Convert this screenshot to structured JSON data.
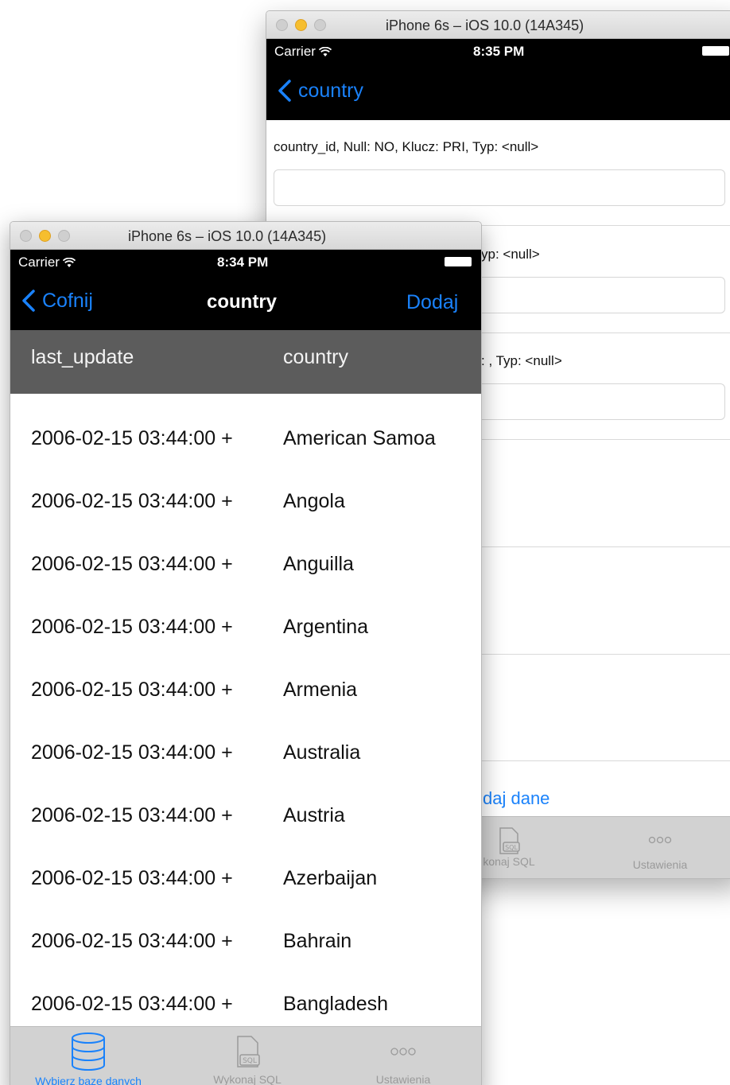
{
  "back_window": {
    "title": "iPhone 6s – iOS 10.0 (14A345)",
    "status": {
      "carrier": "Carrier",
      "time": "8:35 PM"
    },
    "nav": {
      "back_label": "country"
    },
    "fields": [
      {
        "label": "country_id, Null: NO, Klucz: PRI, Typ: <null>"
      },
      {
        "label": "yp: <null>"
      },
      {
        "label": ": , Typ: <null>"
      }
    ],
    "add_link": "daj dane",
    "tabs": [
      {
        "label": "konaj SQL",
        "icon": "sql-icon"
      },
      {
        "label": "Ustawienia",
        "icon": "more-icon"
      }
    ]
  },
  "front_window": {
    "title": "iPhone 6s – iOS 10.0 (14A345)",
    "status": {
      "carrier": "Carrier",
      "time": "8:34 PM"
    },
    "nav": {
      "back_label": "Cofnij",
      "title": "country",
      "action_label": "Dodaj"
    },
    "columns": [
      "last_update",
      "country"
    ],
    "rows": [
      {
        "last_update": "2006-02-15 03:44:00 +",
        "country": "American Samoa"
      },
      {
        "last_update": "2006-02-15 03:44:00 +",
        "country": "Angola"
      },
      {
        "last_update": "2006-02-15 03:44:00 +",
        "country": "Anguilla"
      },
      {
        "last_update": "2006-02-15 03:44:00 +",
        "country": "Argentina"
      },
      {
        "last_update": "2006-02-15 03:44:00 +",
        "country": "Armenia"
      },
      {
        "last_update": "2006-02-15 03:44:00 +",
        "country": "Australia"
      },
      {
        "last_update": "2006-02-15 03:44:00 +",
        "country": "Austria"
      },
      {
        "last_update": "2006-02-15 03:44:00 +",
        "country": "Azerbaijan"
      },
      {
        "last_update": "2006-02-15 03:44:00 +",
        "country": "Bahrain"
      },
      {
        "last_update": "2006-02-15 03:44:00 +",
        "country": "Bangladesh"
      }
    ],
    "tabs": [
      {
        "label": "Wybierz bazę danych",
        "icon": "database-icon",
        "active": true
      },
      {
        "label": "Wykonaj SQL",
        "icon": "sql-icon",
        "active": false
      },
      {
        "label": "Ustawienia",
        "icon": "more-icon",
        "active": false
      }
    ]
  },
  "colors": {
    "accent": "#1a82fb",
    "header_bg": "#5c5c5c",
    "tabbar_bg": "#d2d2d2"
  }
}
